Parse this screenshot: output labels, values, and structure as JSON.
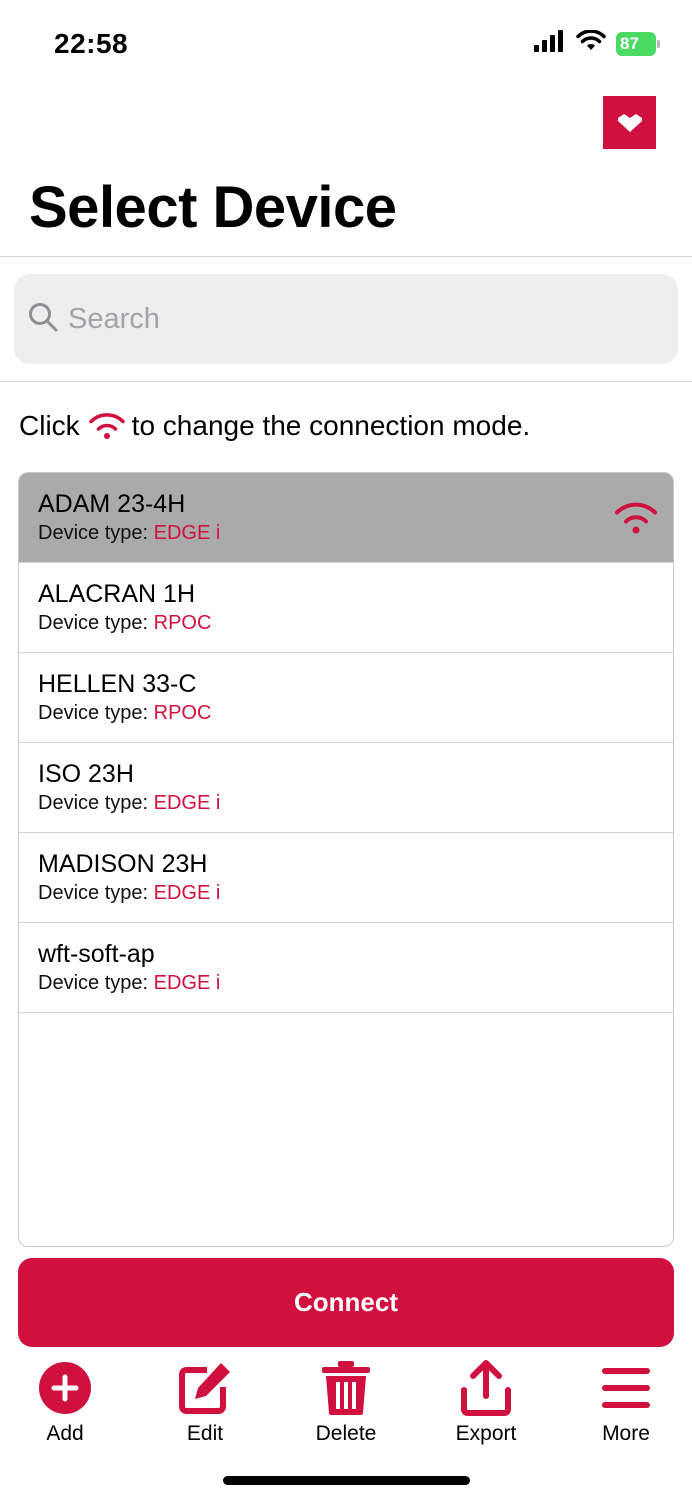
{
  "status_bar": {
    "time": "22:58",
    "battery_level": "87"
  },
  "header": {
    "title": "Select Device"
  },
  "search": {
    "placeholder": "Search",
    "value": ""
  },
  "hint": {
    "prefix": "Click",
    "suffix": "to change the connection mode."
  },
  "devices": [
    {
      "name": "ADAM 23-4H",
      "type_label": "Device type:",
      "type": "EDGE i",
      "selected": true
    },
    {
      "name": "ALACRAN 1H",
      "type_label": "Device type:",
      "type": "RPOC",
      "selected": false
    },
    {
      "name": "HELLEN 33-C",
      "type_label": "Device type:",
      "type": "RPOC",
      "selected": false
    },
    {
      "name": "ISO 23H",
      "type_label": "Device type:",
      "type": "EDGE i",
      "selected": false
    },
    {
      "name": "MADISON 23H",
      "type_label": "Device type:",
      "type": "EDGE i",
      "selected": false
    },
    {
      "name": "wft-soft-ap",
      "type_label": "Device type:",
      "type": "EDGE i",
      "selected": false
    }
  ],
  "connect_label": "Connect",
  "tab_bar": {
    "items": [
      {
        "label": "Add",
        "icon": "plus-circle-icon"
      },
      {
        "label": "Edit",
        "icon": "edit-icon"
      },
      {
        "label": "Delete",
        "icon": "trash-icon"
      },
      {
        "label": "Export",
        "icon": "share-icon"
      },
      {
        "label": "More",
        "icon": "menu-icon"
      }
    ]
  },
  "colors": {
    "accent": "#d0103f",
    "selected_row": "#aaaaaa",
    "battery": "#4cd964"
  }
}
